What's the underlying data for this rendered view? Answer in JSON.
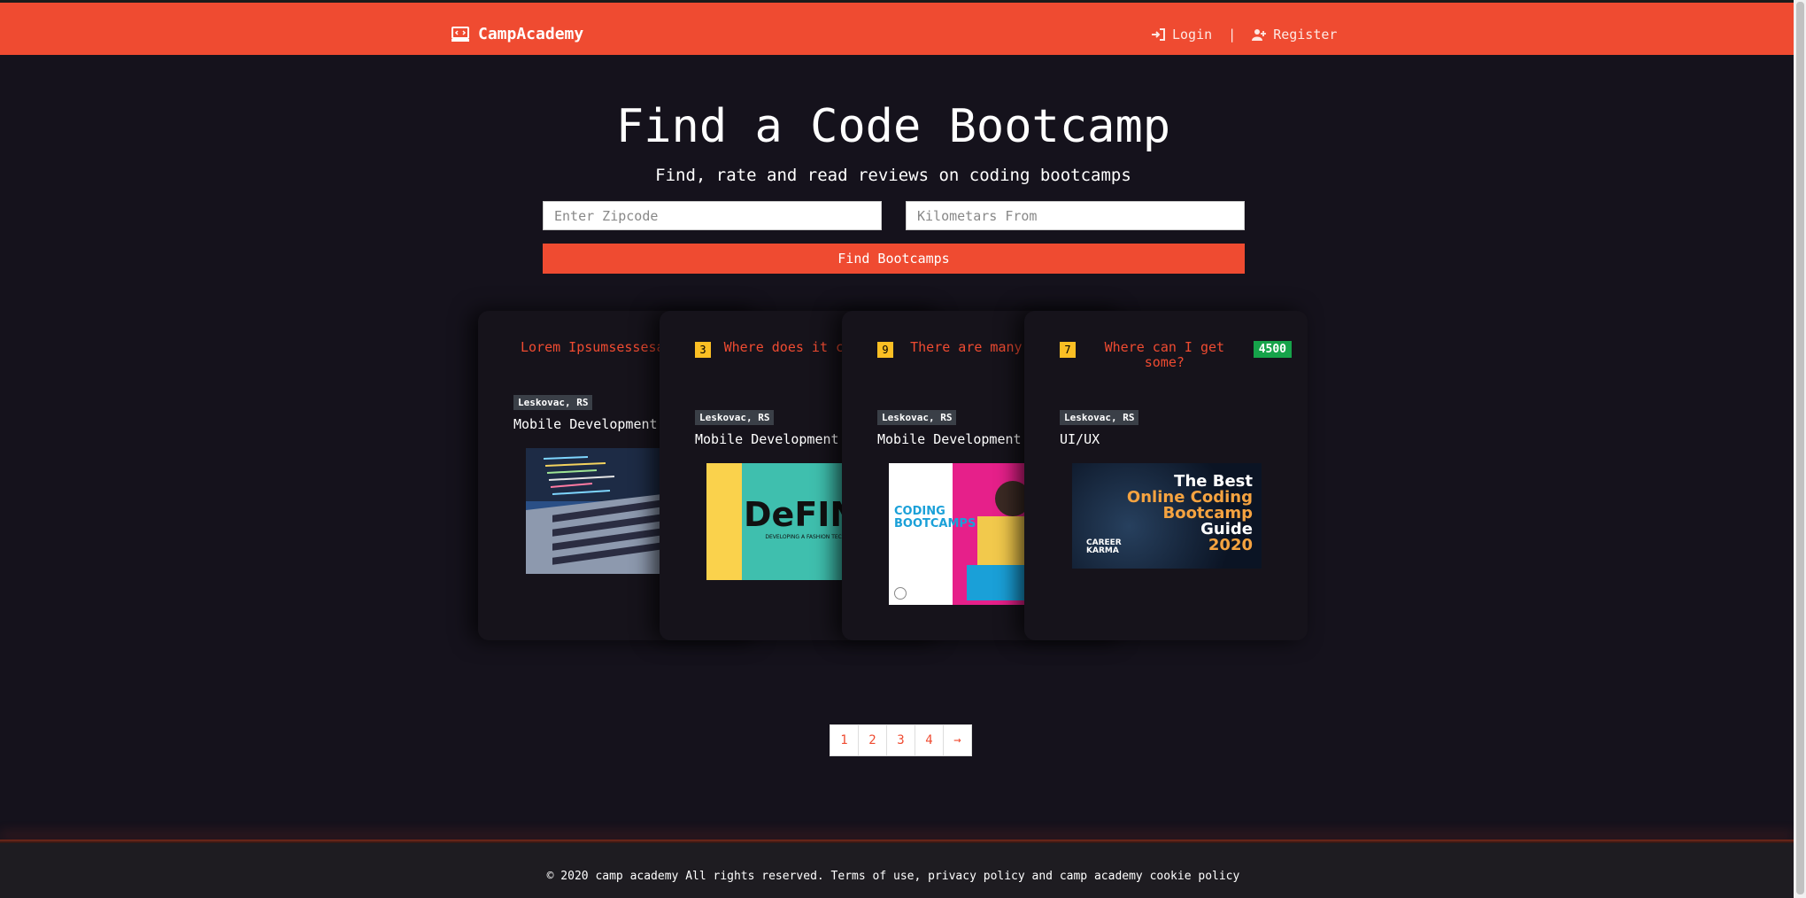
{
  "nav": {
    "brand": "CampAcademy",
    "login_label": "Login",
    "separator": "|",
    "register_label": "Register",
    "color": "#ef4b31"
  },
  "hero": {
    "title": "Find a Code Bootcamp",
    "subtitle": "Find, rate and read reviews on coding bootcamps"
  },
  "search": {
    "zipcode_placeholder": "Enter Zipcode",
    "distance_placeholder": "Kilometars From",
    "button_label": "Find Bootcamps"
  },
  "cards": [
    {
      "title": "Lorem Ipsumsessesa",
      "location": "Leskovac, RS",
      "category": "Mobile Development",
      "image": "laptop-code-photo"
    },
    {
      "number": "3",
      "title": "Where does it come from???",
      "location": "Leskovac, RS",
      "category": "Mobile Development",
      "image": "definition-cover",
      "image_text": "DeFIN",
      "image_subtext": "DEVELOPING A FASHION TECH INNOVATION NETWORK FOR EU"
    },
    {
      "number": "9",
      "title": "There are many variations",
      "location": "Leskovac, RS",
      "category": "Mobile Development",
      "image": "coding-bootcamps-report",
      "image_text": "CODING BOOTCAMPS"
    },
    {
      "number": "7",
      "title": "Where can I get some?",
      "score": "4500",
      "location": "Leskovac, RS",
      "category": "UI/UX",
      "image": "best-online-bootcamp-guide",
      "image_lines": [
        "The Best",
        "Online Coding",
        "Bootcamp",
        "Guide",
        "2020"
      ],
      "image_logo": "CAREER KARMA"
    }
  ],
  "pagination": [
    "1",
    "2",
    "3",
    "4",
    "→"
  ],
  "footer": {
    "text": "© 2020 camp academy All rights reserved. Terms of use, privacy policy and camp academy cookie policy"
  }
}
